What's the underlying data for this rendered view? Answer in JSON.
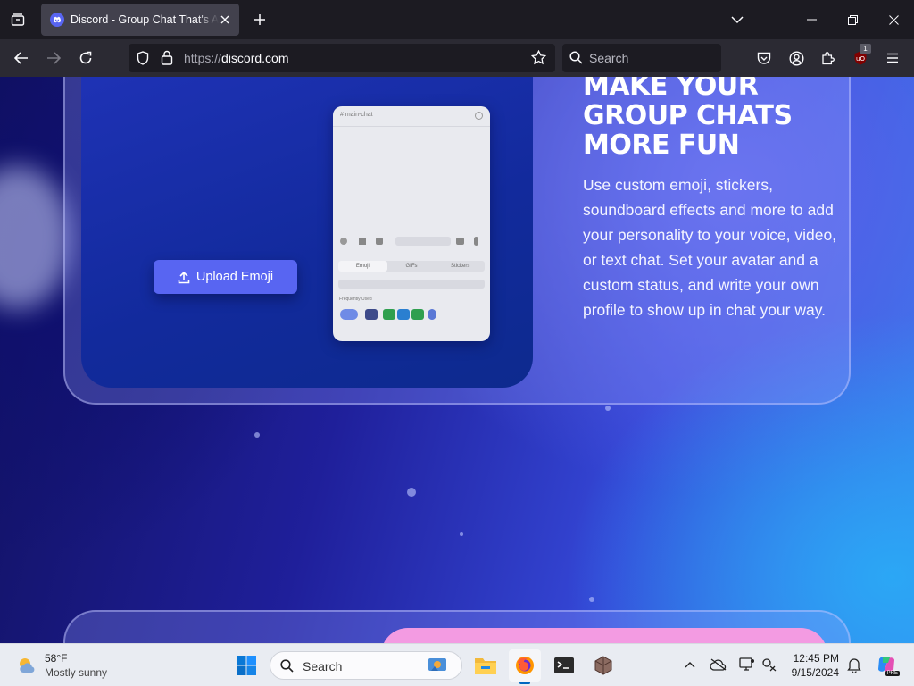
{
  "browser": {
    "tab_title": "Discord - Group Chat That's All Fun & Games",
    "url_prefix": "https://",
    "url_domain": "discord.com",
    "search_placeholder": "Search",
    "extension_badge": "1"
  },
  "page": {
    "upload_button": "Upload Emoji",
    "headline": "MAKE YOUR GROUP CHATS MORE FUN",
    "description": "Use custom emoji, stickers, soundboard effects and more to add your personality to your voice, video, or text chat. Set your avatar and a custom status, and write your own profile to show up in chat your way.",
    "phone": {
      "channel": "# main-chat",
      "tabs": [
        "Emoji",
        "GIFs",
        "Stickers"
      ],
      "section_label": "Frequently Used"
    }
  },
  "taskbar": {
    "temperature": "58°F",
    "weather": "Mostly sunny",
    "search_placeholder": "Search",
    "time": "12:45 PM",
    "date": "9/15/2024"
  },
  "colors": {
    "blurple": "#5865f2",
    "accent_pink": "#f39be2"
  }
}
